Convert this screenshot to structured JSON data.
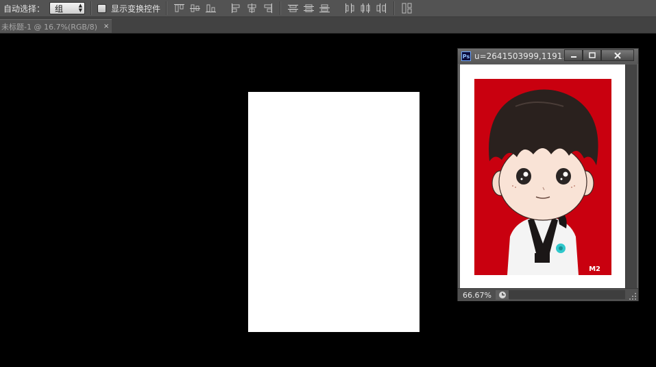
{
  "options_bar": {
    "auto_select_label": "自动选择：",
    "auto_select_value": "组",
    "show_transform_label": "显示变换控件",
    "show_transform_checked": false,
    "align_icons": [
      "align-top-edges-icon",
      "align-vertical-centers-icon",
      "align-bottom-edges-icon",
      "align-left-edges-icon",
      "align-horizontal-centers-icon",
      "align-right-edges-icon"
    ],
    "distribute_icons": [
      "distribute-top-icon",
      "distribute-vertical-center-icon",
      "distribute-bottom-icon",
      "distribute-left-icon",
      "distribute-horizontal-center-icon",
      "distribute-right-icon"
    ],
    "auto_align_icon": "auto-align-layers-icon"
  },
  "document_tab": {
    "title": "未标题-1 @ 16.7%(RGB/8)",
    "close_glyph": "×"
  },
  "floating_window": {
    "app_icon_text": "Ps",
    "title": "u=2641503999,1191...",
    "zoom": "66.67%",
    "photo_watermark": "M2"
  },
  "colors": {
    "app_bg": "#000000",
    "panel": "#535353",
    "photo_bg": "#c9000f"
  }
}
